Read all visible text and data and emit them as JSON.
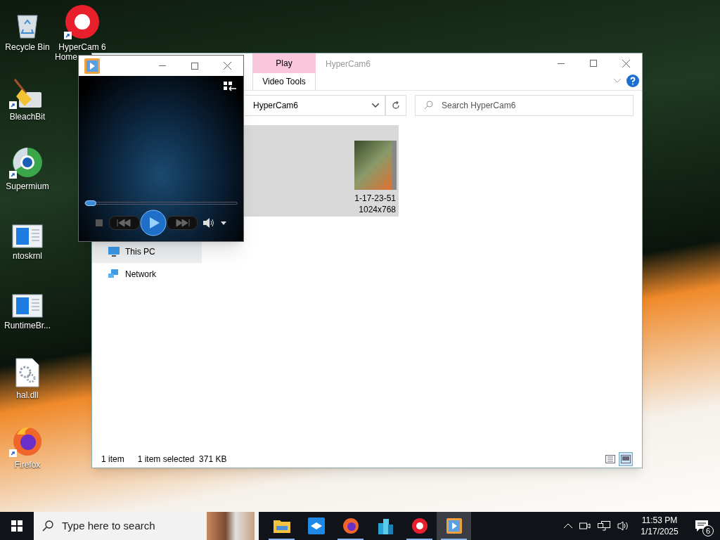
{
  "desktop_icons": [
    {
      "label": "Recycle Bin",
      "kind": "recycle",
      "shortcut": false
    },
    {
      "label": "BleachBit",
      "kind": "broom",
      "shortcut": true
    },
    {
      "label": "Supermium",
      "kind": "browser",
      "shortcut": true
    },
    {
      "label": "ntoskrnl",
      "kind": "window",
      "shortcut": false
    },
    {
      "label": "RuntimeBr...",
      "kind": "window",
      "shortcut": false
    },
    {
      "label": "hal.dll",
      "kind": "file",
      "shortcut": false
    },
    {
      "label": "Firefox",
      "kind": "firefox",
      "shortcut": true
    },
    {
      "label": "HyperCam 6",
      "label_2": "Home",
      "kind": "record",
      "shortcut": true
    }
  ],
  "explorer": {
    "title": "HyperCam6",
    "ribbon_tab": {
      "label": "Play",
      "group": "Video Tools"
    },
    "address": "HyperCam6",
    "search": {
      "placeholder": "Search HyperCam6"
    },
    "nav_items": [
      {
        "label": "This PC",
        "kind": "pc"
      },
      {
        "label": "Network",
        "kind": "network"
      }
    ],
    "files": [
      {
        "name_line_1": "1-17-23-51",
        "name_line_2": "1024x768",
        "selected": true
      }
    ],
    "status": {
      "count": "1 item",
      "selection": "1 item selected  371 KB"
    },
    "views": [
      {
        "kind": "details",
        "selected": false
      },
      {
        "kind": "thumbnails",
        "selected": true
      }
    ]
  },
  "player": {
    "seek": {
      "level": 0.02
    }
  },
  "taskbar": {
    "search": {
      "placeholder": "Type here to search"
    },
    "apps": [
      {
        "kind": "folder",
        "running": true,
        "active": false
      },
      {
        "kind": "box",
        "running": false,
        "active": false
      },
      {
        "kind": "firefox",
        "running": true,
        "active": false
      },
      {
        "kind": "buildings",
        "running": false,
        "active": false
      },
      {
        "kind": "record",
        "running": true,
        "active": false
      },
      {
        "kind": "player",
        "running": true,
        "active": true
      }
    ],
    "time": "11:53 PM",
    "date": "1/17/2025",
    "notifications": "6"
  }
}
